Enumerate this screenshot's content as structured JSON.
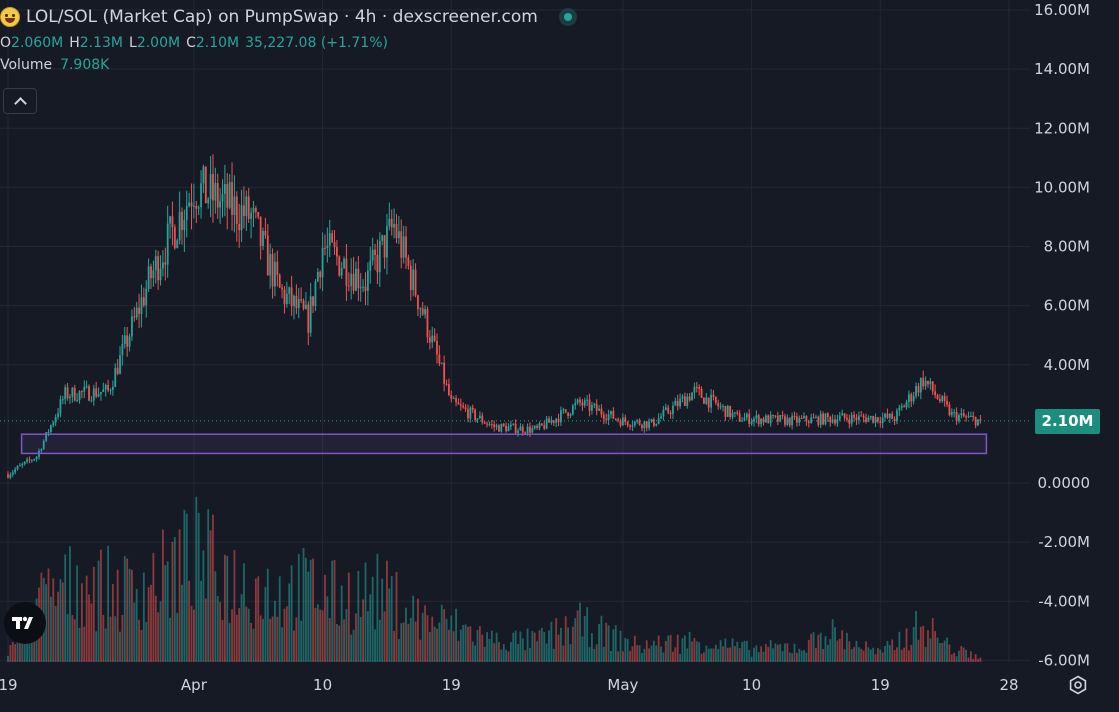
{
  "header": {
    "title": "LOL/SOL (Market Cap) on PumpSwap · 4h · dexscreener.com",
    "ohlc": {
      "o_label": "O",
      "o_value": "2.060M",
      "h_label": "H",
      "h_value": "2.13M",
      "l_label": "L",
      "l_value": "2.00M",
      "c_label": "C",
      "c_value": "2.10M",
      "change": "35,227.08 (+1.71%)"
    },
    "volume_label": "Volume",
    "volume_value": "7.908K"
  },
  "price_badge": "2.10M",
  "colors": {
    "background": "#161a25",
    "up": "#26a69a",
    "down": "#ef5350",
    "zone": "#7e57c2",
    "badge": "#1b8e7e"
  },
  "icons": {
    "token": "token-avatar-icon",
    "status": "live-status-dot-icon",
    "collapse": "chevron-up-icon",
    "logo": "tradingview-logo-icon",
    "settings": "gear-icon"
  },
  "chart_data": {
    "type": "candlestick",
    "title": "LOL/SOL (Market Cap) on PumpSwap · 4h · dexscreener.com",
    "y_tick_labels": [
      "16.00M",
      "14.00M",
      "12.00M",
      "10.00M",
      "8.00M",
      "6.00M",
      "4.00M",
      "2.10M",
      "0.0000",
      "-2.00M",
      "-4.00M",
      "-6.00M"
    ],
    "x_tick_labels": [
      "19",
      "Apr",
      "10",
      "19",
      "May",
      "10",
      "19",
      "28"
    ],
    "ylim": [
      -6000000,
      16000000
    ],
    "last_close": 2100000,
    "support_zone": {
      "from_date": "Mar 21",
      "to_date": "May 26",
      "low": 1000000,
      "high": 1650000
    },
    "market_cap_series": [
      {
        "date": "Mar 19",
        "close": 300000
      },
      {
        "date": "Mar 21",
        "close": 900000
      },
      {
        "date": "Mar 23",
        "close": 3000000
      },
      {
        "date": "Mar 26",
        "close": 3100000
      },
      {
        "date": "Mar 29",
        "close": 7000000
      },
      {
        "date": "Apr 1",
        "close": 10000000
      },
      {
        "date": "Apr 3",
        "close": 9500000
      },
      {
        "date": "Apr 5",
        "close": 9000000
      },
      {
        "date": "Apr 7",
        "close": 6500000
      },
      {
        "date": "Apr 9",
        "close": 5500000
      },
      {
        "date": "Apr 10",
        "close": 8000000
      },
      {
        "date": "Apr 13",
        "close": 6800000
      },
      {
        "date": "Apr 15",
        "close": 8700000
      },
      {
        "date": "Apr 17",
        "close": 5800000
      },
      {
        "date": "Apr 19",
        "close": 2700000
      },
      {
        "date": "Apr 22",
        "close": 1900000
      },
      {
        "date": "Apr 25",
        "close": 1800000
      },
      {
        "date": "Apr 28",
        "close": 2700000
      },
      {
        "date": "May 1",
        "close": 2100000
      },
      {
        "date": "May 3",
        "close": 2000000
      },
      {
        "date": "May 6",
        "close": 3100000
      },
      {
        "date": "May 9",
        "close": 2200000
      },
      {
        "date": "May 13",
        "close": 2100000
      },
      {
        "date": "May 16",
        "close": 2200000
      },
      {
        "date": "May 20",
        "close": 2200000
      },
      {
        "date": "May 22",
        "close": 3500000
      },
      {
        "date": "May 24",
        "close": 2300000
      },
      {
        "date": "May 26",
        "close": 2100000
      }
    ],
    "volume_series": [
      {
        "date": "Mar 19",
        "value": 0.1
      },
      {
        "date": "Mar 21",
        "value": 0.55
      },
      {
        "date": "Mar 24",
        "value": 0.75
      },
      {
        "date": "Mar 27",
        "value": 0.65
      },
      {
        "date": "Mar 30",
        "value": 0.8
      },
      {
        "date": "Apr 1",
        "value": 1.0
      },
      {
        "date": "Apr 4",
        "value": 0.75
      },
      {
        "date": "Apr 7",
        "value": 0.65
      },
      {
        "date": "Apr 9",
        "value": 0.7
      },
      {
        "date": "Apr 11",
        "value": 0.6
      },
      {
        "date": "Apr 14",
        "value": 0.65
      },
      {
        "date": "Apr 17",
        "value": 0.4
      },
      {
        "date": "Apr 19",
        "value": 0.35
      },
      {
        "date": "Apr 22",
        "value": 0.2
      },
      {
        "date": "Apr 25",
        "value": 0.2
      },
      {
        "date": "Apr 28",
        "value": 0.35
      },
      {
        "date": "May 2",
        "value": 0.15
      },
      {
        "date": "May 6",
        "value": 0.2
      },
      {
        "date": "May 10",
        "value": 0.12
      },
      {
        "date": "May 14",
        "value": 0.15
      },
      {
        "date": "May 15",
        "value": 0.3
      },
      {
        "date": "May 19",
        "value": 0.08
      },
      {
        "date": "May 22",
        "value": 0.35
      },
      {
        "date": "May 24",
        "value": 0.12
      },
      {
        "date": "May 26",
        "value": 0.05
      }
    ]
  }
}
